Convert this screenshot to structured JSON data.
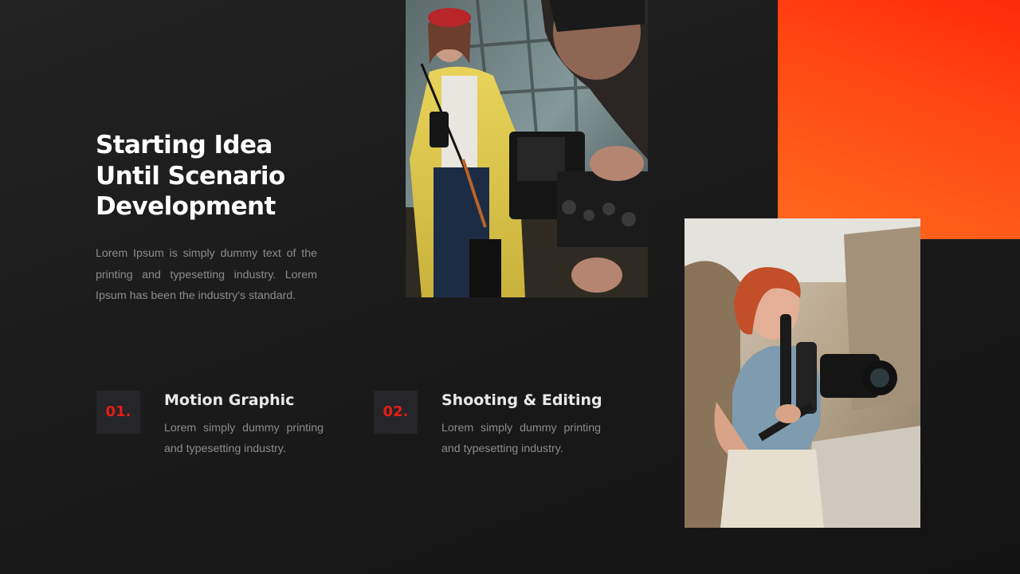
{
  "slide": {
    "heading_lines": [
      "Starting Idea",
      "Until Scenario",
      "Development"
    ],
    "intro": "Lorem Ipsum is simply dummy text of the printing and typesetting industry.  Lorem Ipsum has been the industry's standard.",
    "accent_color": "#ff4a14",
    "number_color": "#e41e12"
  },
  "features": [
    {
      "number": "01.",
      "title": "Motion Graphic",
      "description": "Lorem simply dummy printing and typesetting industry."
    },
    {
      "number": "02.",
      "title": "Shooting & Editing",
      "description": "Lorem simply dummy printing and typesetting industry."
    }
  ],
  "images": {
    "crew_photo": "camera-operator-photo",
    "woman_photo": "woman-with-gimbal-camera-photo"
  }
}
